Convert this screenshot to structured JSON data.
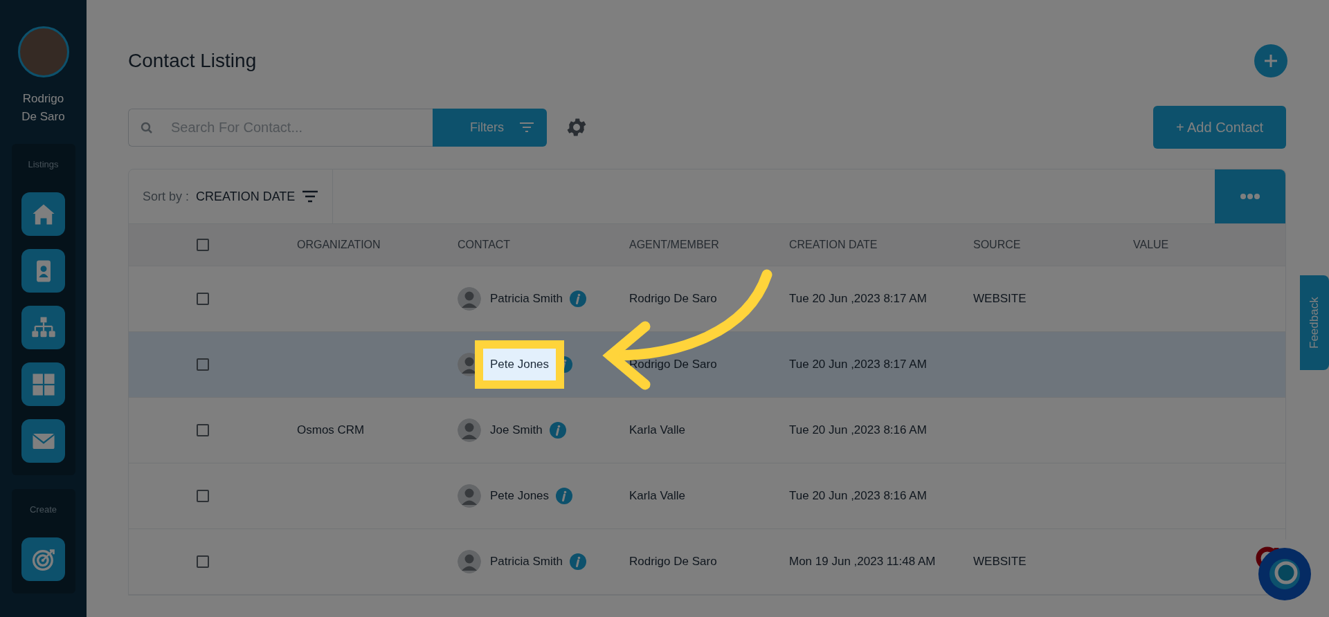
{
  "user": {
    "name": "Rodrigo De Saro"
  },
  "sidebar": {
    "sections": [
      {
        "title": "Listings",
        "items": [
          {
            "kind": "home"
          },
          {
            "kind": "contact"
          },
          {
            "kind": "hierarchy"
          },
          {
            "kind": "grid"
          },
          {
            "kind": "mail"
          }
        ]
      },
      {
        "title": "Create",
        "items": [
          {
            "kind": "target"
          }
        ]
      }
    ]
  },
  "page": {
    "title": "Contact Listing"
  },
  "search": {
    "placeholder": "Search For Contact..."
  },
  "filters_button": "Filters",
  "add_contact_button": "+ Add Contact",
  "sort": {
    "label": "Sort by :",
    "value": "CREATION DATE"
  },
  "table": {
    "all_checked": false,
    "columns": [
      "ORGANIZATION",
      "CONTACT",
      "AGENT/MEMBER",
      "CREATION DATE",
      "SOURCE",
      "VALUE"
    ],
    "rows": [
      {
        "checked": false,
        "selected": false,
        "contact": "Patricia Smith",
        "highlighted": false,
        "agent": "Rodrigo De Saro",
        "creation_date": "Tue 20 Jun ,2023 8:17 AM",
        "source": "WEBSITE"
      },
      {
        "checked": false,
        "selected": true,
        "contact": "Pete Jones",
        "highlighted": true,
        "agent": "Rodrigo De Saro",
        "creation_date": "Tue 20 Jun ,2023 8:17 AM"
      },
      {
        "checked": false,
        "selected": false,
        "organization": "Osmos CRM",
        "contact": "Joe Smith",
        "highlighted": false,
        "agent": "Karla Valle",
        "creation_date": "Tue 20 Jun ,2023 8:16 AM"
      },
      {
        "checked": false,
        "selected": false,
        "contact": "Pete Jones",
        "highlighted": false,
        "agent": "Karla Valle",
        "creation_date": "Tue 20 Jun ,2023 8:16 AM"
      },
      {
        "checked": false,
        "selected": false,
        "contact": "Patricia Smith",
        "highlighted": false,
        "agent": "Rodrigo De Saro",
        "creation_date": "Mon 19 Jun ,2023 11:48 AM",
        "source": "WEBSITE"
      }
    ]
  },
  "feedback_tab": "Feedback"
}
